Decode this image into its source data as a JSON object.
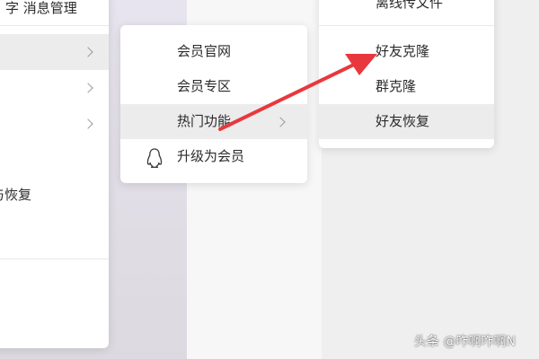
{
  "menu_main": {
    "top_partial": "字 消息管理",
    "items_partial": [
      "",
      "",
      ""
    ],
    "partial_label": "与恢复"
  },
  "menu_vip": {
    "items": [
      {
        "label": "会员官网"
      },
      {
        "label": "会员专区"
      },
      {
        "label": "热门功能"
      },
      {
        "label": "升级为会员"
      }
    ]
  },
  "menu_hot": {
    "items": [
      {
        "label": "离线传文件"
      },
      {
        "label": "好友克隆"
      },
      {
        "label": "群克隆"
      },
      {
        "label": "好友恢复"
      }
    ]
  },
  "annotation": {
    "arrow_color": "#e8383d"
  },
  "watermark": "头条 @咋啊咋啊N"
}
